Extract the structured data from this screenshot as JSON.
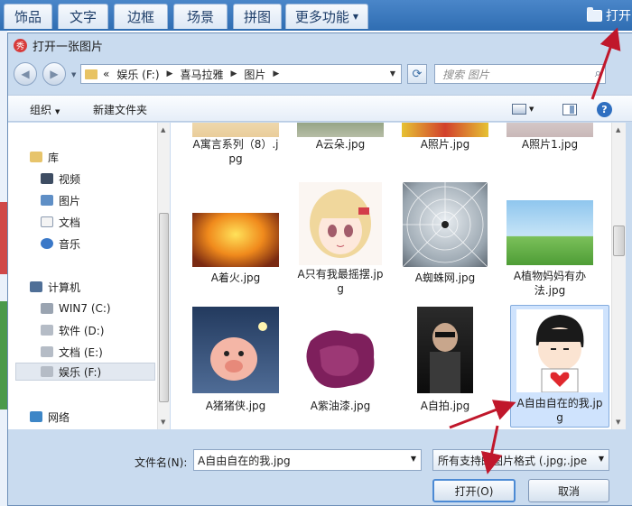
{
  "app_bar": {
    "tabs": [
      "饰品",
      "文字",
      "边框",
      "场景",
      "拼图"
    ],
    "more_label": "更多功能",
    "open_label": "打开"
  },
  "dialog": {
    "title": "打开一张图片",
    "breadcrumb": [
      "娱乐 (F:)",
      "喜马拉雅",
      "图片"
    ],
    "breadcrumb_prefix": "«",
    "search_placeholder": "搜索 图片",
    "toolbar": {
      "organize": "组织",
      "new_folder": "新建文件夹"
    },
    "nav": {
      "items": [
        {
          "label": "库",
          "icon": "library-icon"
        },
        {
          "label": "视频",
          "icon": "video-icon"
        },
        {
          "label": "图片",
          "icon": "pictures-icon"
        },
        {
          "label": "文档",
          "icon": "documents-icon"
        },
        {
          "label": "音乐",
          "icon": "music-icon"
        },
        {
          "label": "计算机",
          "icon": "computer-icon"
        },
        {
          "label": "WIN7 (C:)",
          "icon": "drive-icon"
        },
        {
          "label": "软件 (D:)",
          "icon": "drive-icon"
        },
        {
          "label": "文档 (E:)",
          "icon": "drive-icon"
        },
        {
          "label": "娱乐 (F:)",
          "icon": "drive-icon"
        },
        {
          "label": "网络",
          "icon": "network-icon"
        }
      ],
      "selected": "娱乐 (F:)"
    },
    "files": [
      {
        "name": "A寓言系列（8）.jpg",
        "thumb": "sand"
      },
      {
        "name": "A云朵.jpg",
        "thumb": "cloud"
      },
      {
        "name": "A照片.jpg",
        "thumb": "flowers"
      },
      {
        "name": "A照片1.jpg",
        "thumb": "photo"
      },
      {
        "name": "A着火.jpg",
        "thumb": "fire"
      },
      {
        "name": "A只有我最摇摆.jpg",
        "thumb": "anime-girl"
      },
      {
        "name": "A蜘蛛网.jpg",
        "thumb": "spider-web"
      },
      {
        "name": "A植物妈妈有办法.jpg",
        "thumb": "landscape"
      },
      {
        "name": "A猪猪侠.jpg",
        "thumb": "pig"
      },
      {
        "name": "A紫油漆.jpg",
        "thumb": "paint"
      },
      {
        "name": "A自拍.jpg",
        "thumb": "selfie"
      },
      {
        "name": "A自由自在的我.jpg",
        "thumb": "cartoon-boy"
      }
    ],
    "selected_file": "A自由自在的我.jpg",
    "filename_label": "文件名(N):",
    "filename_value": "A自由自在的我.jpg",
    "filetype_value": "所有支持的图片格式 (.jpg;.jpe",
    "open_button": "打开(O)",
    "cancel_button": "取消"
  },
  "colors": {
    "app_bar": "#2f6db2",
    "dialog_frame": "#c9dbef",
    "selection": "#cfe3fd",
    "annotation_arrow": "#c0172b"
  }
}
